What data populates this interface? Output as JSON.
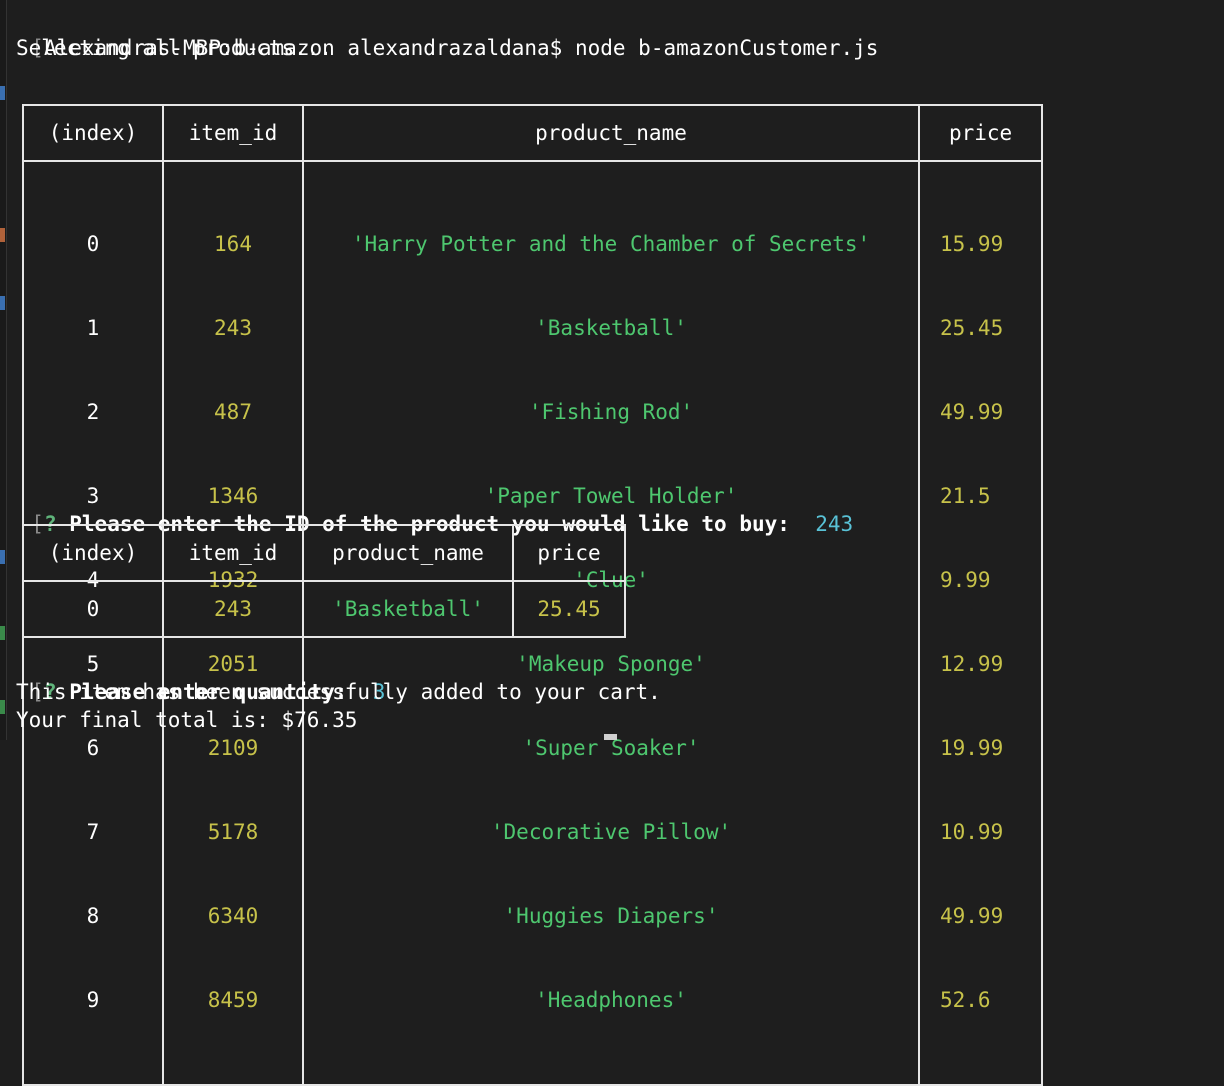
{
  "terminal": {
    "prompt_line": "Alexandras-MBP:b-amazon alexandrazaldana$ node b-amazonCustomer.js",
    "selecting_msg": "Selecting all products...",
    "question_mark": "?",
    "id_question": "Please enter the ID of the product you would like to buy:",
    "id_answer": "243",
    "qty_question": "Please enter quantity:",
    "qty_answer": "3",
    "success_msg": "This item has been successfully added to your cart.",
    "total_msg": "Your final total is: $76.35"
  },
  "table_all": {
    "headers": [
      "(index)",
      "item_id",
      "product_name",
      "price"
    ],
    "rows": [
      {
        "index": "0",
        "item_id": "164",
        "product_name": "'Harry Potter and the Chamber of Secrets'",
        "price": "15.99"
      },
      {
        "index": "1",
        "item_id": "243",
        "product_name": "'Basketball'",
        "price": "25.45"
      },
      {
        "index": "2",
        "item_id": "487",
        "product_name": "'Fishing Rod'",
        "price": "49.99"
      },
      {
        "index": "3",
        "item_id": "1346",
        "product_name": "'Paper Towel Holder'",
        "price": "21.5"
      },
      {
        "index": "4",
        "item_id": "1932",
        "product_name": "'Clue'",
        "price": "9.99"
      },
      {
        "index": "5",
        "item_id": "2051",
        "product_name": "'Makeup Sponge'",
        "price": "12.99"
      },
      {
        "index": "6",
        "item_id": "2109",
        "product_name": "'Super Soaker'",
        "price": "19.99"
      },
      {
        "index": "7",
        "item_id": "5178",
        "product_name": "'Decorative Pillow'",
        "price": "10.99"
      },
      {
        "index": "8",
        "item_id": "6340",
        "product_name": "'Huggies Diapers'",
        "price": "49.99"
      },
      {
        "index": "9",
        "item_id": "8459",
        "product_name": "'Headphones'",
        "price": "52.6"
      }
    ]
  },
  "table_selected": {
    "headers": [
      "(index)",
      "item_id",
      "product_name",
      "price"
    ],
    "rows": [
      {
        "index": "0",
        "item_id": "243",
        "product_name": "'Basketball'",
        "price": "25.45"
      }
    ]
  },
  "colors": {
    "background": "#1e1e1e",
    "number": "#c7c24a",
    "string": "#4ec76f",
    "answer": "#59c2d6"
  }
}
